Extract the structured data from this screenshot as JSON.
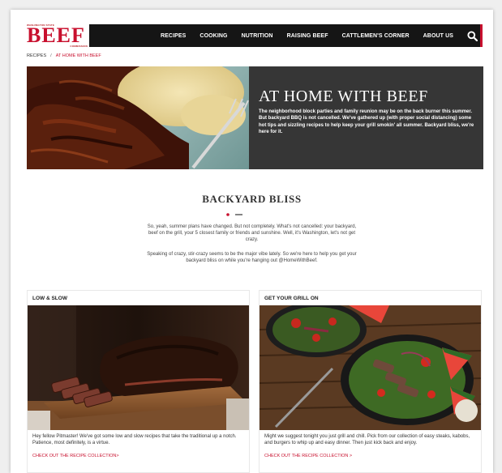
{
  "logo": {
    "top": "WASHINGTON STATE",
    "word": "BEEF",
    "bottom": "COMMISSION"
  },
  "nav": {
    "items": [
      "RECIPES",
      "COOKING",
      "NUTRITION",
      "RAISING BEEF",
      "CATTLEMEN'S CORNER",
      "ABOUT US"
    ],
    "search_icon": "search-icon"
  },
  "breadcrumb": {
    "parent": "RECIPES",
    "separator": "/",
    "current": "AT HOME WITH BEEF"
  },
  "hero": {
    "title": "AT HOME WITH BEEF",
    "text": "The neighborhood block parties and family reunion may be on the back burner this summer. But backyard BBQ is not cancelled. We've gathered up (with proper social distancing) some hot tips and sizzling recipes to help keep your grill smokin' all summer. Backyard bliss, we're here for it."
  },
  "intro": {
    "title": "BACKYARD BLISS",
    "para1": "So, yeah, summer plans have changed. But not completely. What's not cancelled: your backyard, beef on the grill, your 5 closest family or friends and sunshine. Well, it's Washington, let's not get crazy.",
    "para2": "Speaking of crazy, stir-crazy seems to be the major vibe lately. So we're here to help you get your backyard bliss on while you're hanging out @HomeWithBeef."
  },
  "cards": [
    {
      "heading": "LOW & SLOW",
      "text": "Hey fellow Pitmaster! We've got some low and slow recipes that take the traditional up a notch. Patience, most definitely, is a virtue.",
      "link": "CHECK OUT THE RECIPE COLLECTION>"
    },
    {
      "heading": "GET YOUR GRILL ON",
      "text": "Might we suggest tonight you just grill and chill. Pick from our collection of easy steaks, kabobs, and burgers to whip up and easy dinner. Then just kick back and enjoy.",
      "link": "CHECK OUT THE RECIPE COLLECTION >"
    }
  ],
  "colors": {
    "brand_red": "#c8102e",
    "nav_bg": "#151515",
    "hero_panel": "#363636"
  }
}
